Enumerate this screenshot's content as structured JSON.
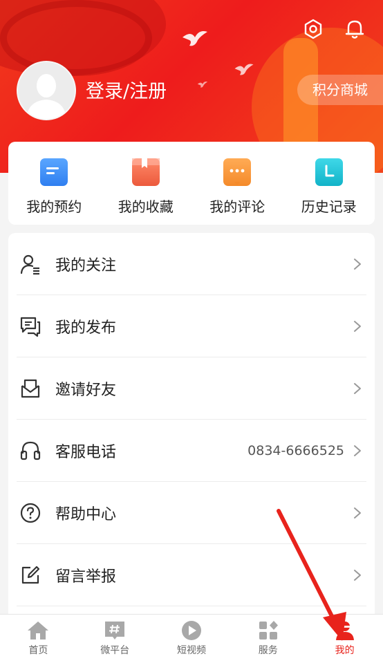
{
  "header": {
    "login_label": "登录/注册",
    "points_mall_label": "积分商城"
  },
  "quick_actions": [
    {
      "label": "我的预约",
      "color": "#3b8ff5"
    },
    {
      "label": "我的收藏",
      "color": "#f06a4e"
    },
    {
      "label": "我的评论",
      "color": "#f7963a"
    },
    {
      "label": "历史记录",
      "color": "#20c4d8"
    }
  ],
  "menu": [
    {
      "label": "我的关注",
      "icon": "user-follow-icon",
      "value": ""
    },
    {
      "label": "我的发布",
      "icon": "chat-publish-icon",
      "value": ""
    },
    {
      "label": "邀请好友",
      "icon": "envelope-icon",
      "value": ""
    },
    {
      "label": "客服电话",
      "icon": "headset-icon",
      "value": "0834-6666525"
    },
    {
      "label": "帮助中心",
      "icon": "help-circle-icon",
      "value": ""
    },
    {
      "label": "留言举报",
      "icon": "edit-report-icon",
      "value": ""
    }
  ],
  "bottom_nav": [
    {
      "label": "首页",
      "icon": "home-icon",
      "active": false
    },
    {
      "label": "微平台",
      "icon": "hashtag-icon",
      "active": false
    },
    {
      "label": "短视频",
      "icon": "play-icon",
      "active": false
    },
    {
      "label": "服务",
      "icon": "grid-icon",
      "active": false
    },
    {
      "label": "我的",
      "icon": "profile-icon",
      "active": true
    }
  ],
  "colors": {
    "brand_red": "#ee1c1c",
    "active_nav": "#e8231c"
  }
}
